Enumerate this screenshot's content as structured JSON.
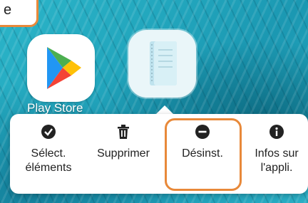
{
  "corner": {
    "text": "e"
  },
  "home": {
    "apps": [
      {
        "label": "Play Store",
        "icon": "play-store-icon"
      },
      {
        "label": "",
        "icon": "notebook-icon"
      }
    ]
  },
  "context_menu": {
    "items": [
      {
        "label": "Sélect. éléments",
        "icon": "check-circle-icon"
      },
      {
        "label": "Supprimer",
        "icon": "trash-icon"
      },
      {
        "label": "Désinst.",
        "icon": "minus-circle-icon"
      },
      {
        "label": "Infos sur l'appli.",
        "icon": "info-circle-icon"
      }
    ],
    "highlighted_item": "Désinst.",
    "highlight_color": "#e8893a"
  }
}
